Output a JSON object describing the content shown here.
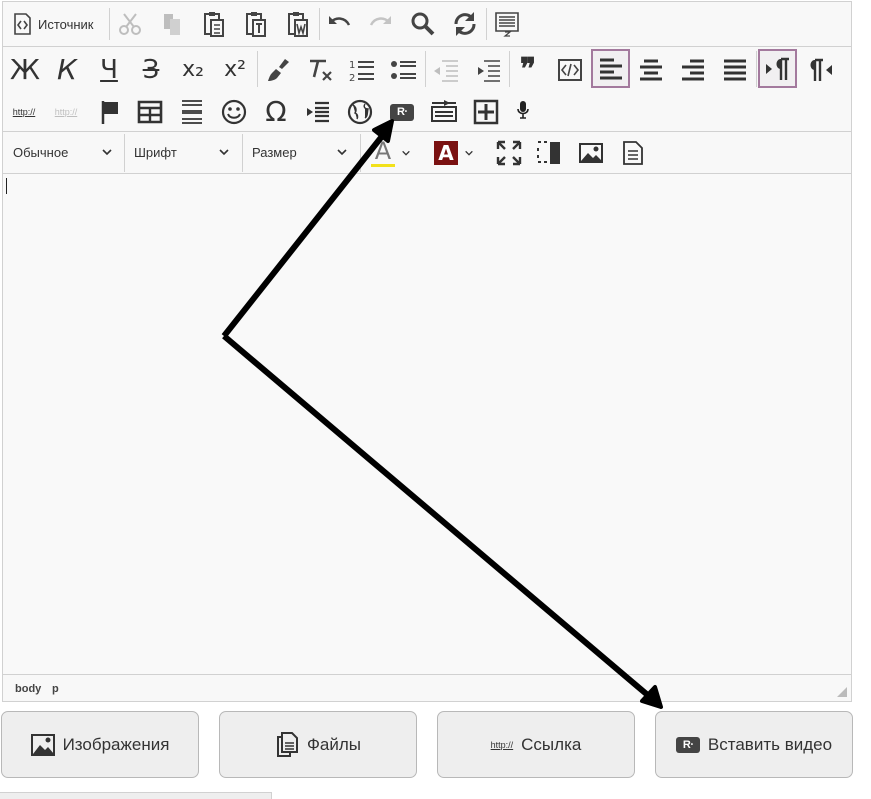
{
  "toolbar": {
    "source_label": "Источник",
    "bold_glyph": "Ж",
    "italic_glyph": "К",
    "underline_glyph": "Ч",
    "strike_glyph": "З",
    "subscript_glyph": "x₂",
    "superscript_glyph": "x²",
    "quote_glyph": "❞",
    "omega_glyph": "Ω",
    "rutube_glyph": "R",
    "format_combo": "Обычное",
    "font_combo": "Шрифт",
    "size_combo": "Размер",
    "text_color_glyph": "A",
    "bg_color_glyph": "A",
    "link_glyph": "http://",
    "unlink_glyph": "http://"
  },
  "statusbar": {
    "path_body": "body",
    "path_p": "p"
  },
  "buttons": {
    "images_label": "Изображения",
    "files_label": "Файлы",
    "link_label": "Ссылка",
    "link_icon_text": "http://",
    "video_label": "Вставить видео",
    "video_icon_text": "R"
  },
  "colors": {
    "active_border": "#a3799d",
    "bg_color_swatch": "#7a1111",
    "text_color_underline": "#f2e11a",
    "arrow": "#000000"
  },
  "icons": [
    "source-icon",
    "cut-icon",
    "copy-icon",
    "paste-icon",
    "paste-text-icon",
    "paste-word-icon",
    "undo-icon",
    "redo-icon",
    "find-icon",
    "replace-icon",
    "select-all-icon",
    "remove-format-icon",
    "numbered-list-icon",
    "bullet-list-icon",
    "outdent-icon",
    "indent-icon",
    "code-snippet-icon",
    "align-left-icon",
    "align-center-icon",
    "align-right-icon",
    "justify-icon",
    "ltr-icon",
    "rtl-icon",
    "anchor-icon",
    "table-icon",
    "horizontal-rule-icon",
    "smiley-icon",
    "iframe-icon",
    "page-break-icon",
    "add-icon",
    "microphone-icon",
    "maximize-icon",
    "show-blocks-icon",
    "image-icon",
    "templates-icon",
    "images-icon",
    "files-icon"
  ]
}
